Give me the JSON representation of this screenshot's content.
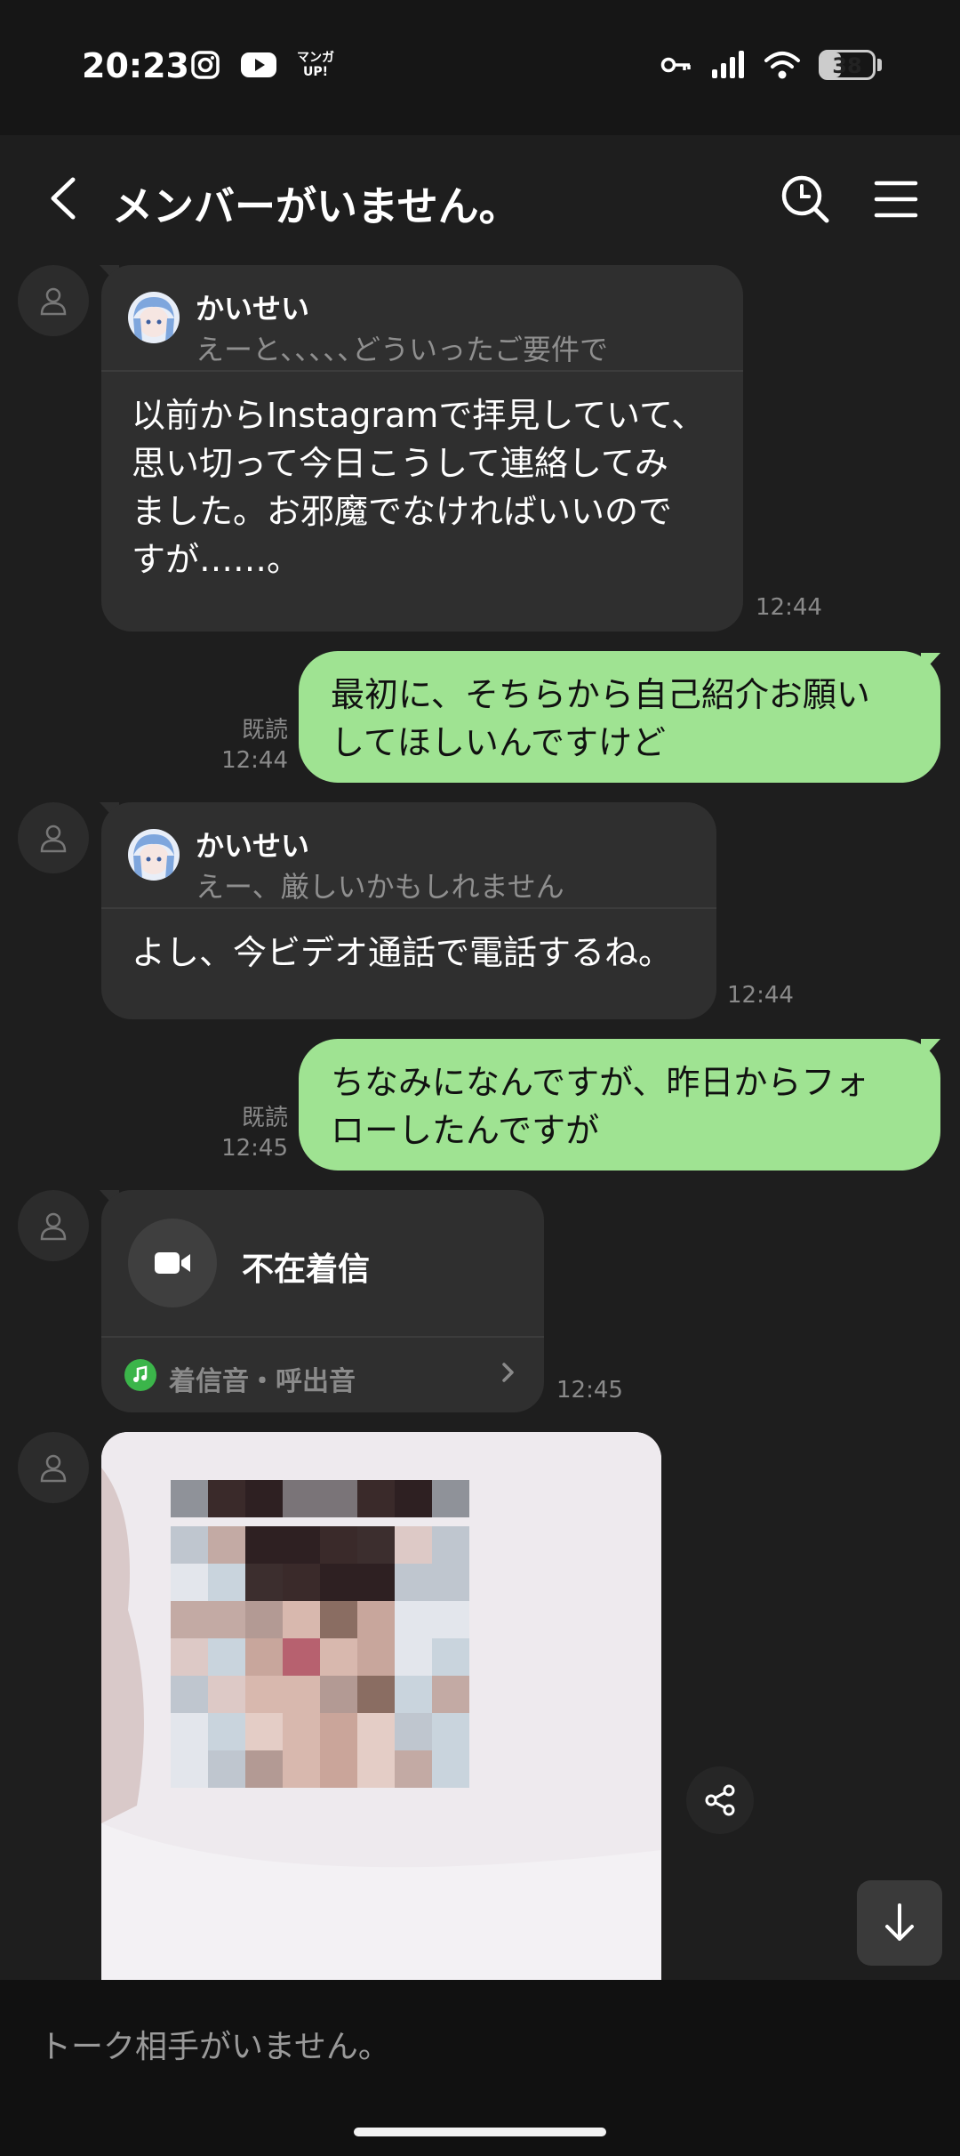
{
  "status_bar": {
    "time": "20:23",
    "apps": [
      "instagram-icon",
      "youtube-icon",
      "manga-up-icon"
    ],
    "manga_label_top": "マンガ",
    "manga_label_bottom": "UP!",
    "battery": "38",
    "battery_level": 0.38
  },
  "header": {
    "title": "メンバーがいません。"
  },
  "messages": [
    {
      "type": "incoming",
      "reply_name": "かいせい",
      "reply_text": "えーと､､､､､どういったご要件で",
      "lines": [
        "以前からInstagramで拝見していて、",
        "思い切って今日こうして連絡してみ",
        "ました。お邪魔でなければいいので",
        "すが……。"
      ],
      "time": "12:44"
    },
    {
      "type": "outgoing",
      "lines": [
        "最初に、そちらから自己紹介お願い",
        "してほしいんですけど"
      ],
      "read": "既読",
      "time": "12:44"
    },
    {
      "type": "incoming",
      "reply_name": "かいせい",
      "reply_text": "えー、厳しいかもしれません",
      "lines": [
        "よし、今ビデオ通話で電話するね。"
      ],
      "time": "12:44"
    },
    {
      "type": "outgoing",
      "lines": [
        "ちなみになんですが、昨日からフォ",
        "ローしたんですが"
      ],
      "read": "既読",
      "time": "12:45"
    },
    {
      "type": "missed_call",
      "label": "不在着信",
      "ringtone": "着信音・呼出音",
      "time": "12:45"
    }
  ],
  "footer": {
    "placeholder": "トーク相手がいません。"
  },
  "colors": {
    "background": "#1e1e1e",
    "incoming_bubble": "#2f2f2f",
    "outgoing_bubble": "#9fe392",
    "ring_icon": "#3bb54a"
  }
}
